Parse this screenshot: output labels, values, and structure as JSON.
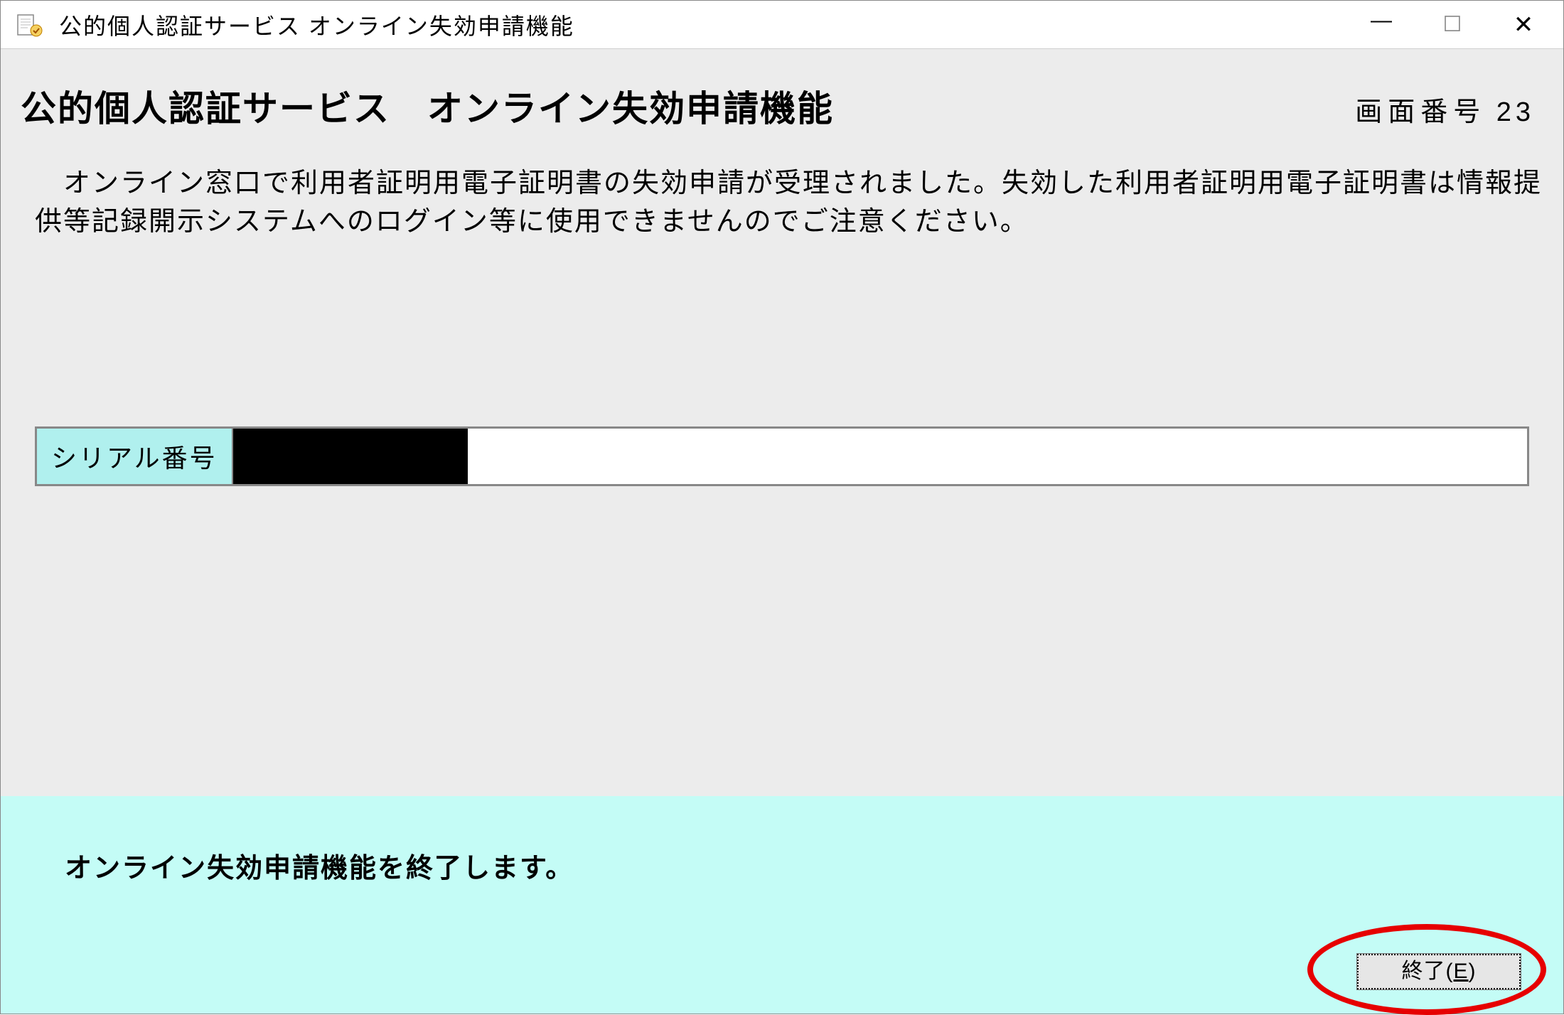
{
  "titlebar": {
    "title": "公的個人認証サービス オンライン失効申請機能"
  },
  "header": {
    "page_title": "公的個人認証サービス　オンライン失効申請機能",
    "screen_number_label": "画面番号",
    "screen_number_value": "23"
  },
  "main": {
    "message": "　オンライン窓口で利用者証明用電子証明書の失効申請が受理されました。失効した利用者証明用電子証明書は情報提供等記録開示システムへのログイン等に使用できませんのでご注意ください。",
    "serial_label": "シリアル番号",
    "serial_value_redacted": true
  },
  "footer": {
    "message": "オンライン失効申請機能を終了します。",
    "exit_label_prefix": "終了(",
    "exit_label_key": "E",
    "exit_label_suffix": ")"
  },
  "colors": {
    "footer_bg": "#c4fcf6",
    "label_bg": "#b0f0ee",
    "highlight": "#e60000"
  }
}
